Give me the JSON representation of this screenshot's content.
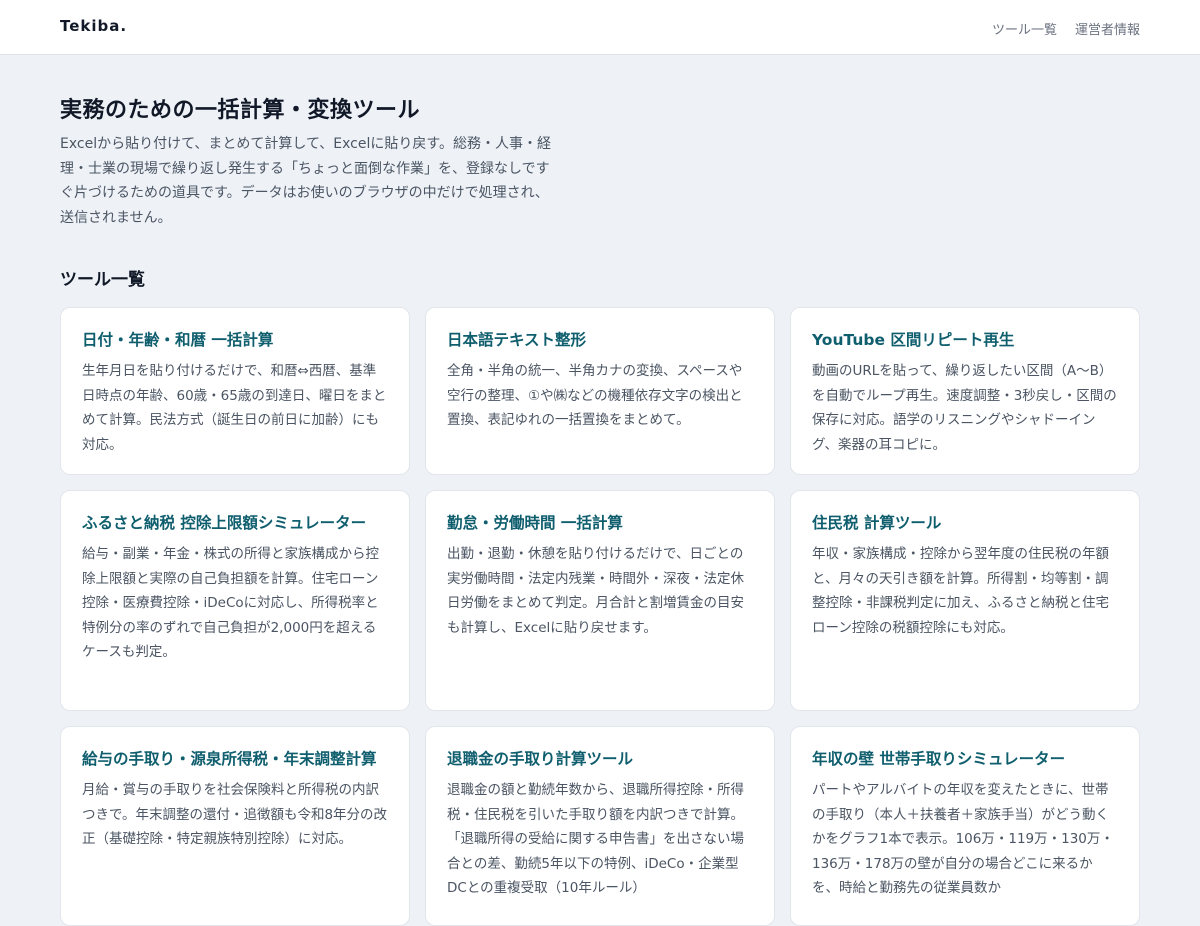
{
  "header": {
    "logo": "Tekiba.",
    "nav": [
      {
        "label": "ツール一覧"
      },
      {
        "label": "運営者情報"
      }
    ]
  },
  "hero": {
    "title": "実務のための一括計算・変換ツール",
    "description": "Excelから貼り付けて、まとめて計算して、Excelに貼り戻す。総務・人事・経理・士業の現場で繰り返し発生する「ちょっと面倒な作業」を、登録なしですぐ片づけるための道具です。データはお使いのブラウザの中だけで処理され、送信されません。"
  },
  "tools": {
    "section_title": "ツール一覧",
    "cards": [
      {
        "title": "日付・年齢・和暦 一括計算",
        "description": "生年月日を貼り付けるだけで、和暦⇔西暦、基準日時点の年齢、60歳・65歳の到達日、曜日をまとめて計算。民法方式（誕生日の前日に加齢）にも対応。"
      },
      {
        "title": "日本語テキスト整形",
        "description": "全角・半角の統一、半角カナの変換、スペースや空行の整理、①や㈱などの機種依存文字の検出と置換、表記ゆれの一括置換をまとめて。"
      },
      {
        "title": "YouTube 区間リピート再生",
        "description": "動画のURLを貼って、繰り返したい区間（A〜B）を自動でループ再生。速度調整・3秒戻し・区間の保存に対応。語学のリスニングやシャドーイング、楽器の耳コピに。"
      },
      {
        "title": "ふるさと納税 控除上限額シミュレーター",
        "description": "給与・副業・年金・株式の所得と家族構成から控除上限額と実際の自己負担額を計算。住宅ローン控除・医療費控除・iDeCoに対応し、所得税率と特例分の率のずれで自己負担が2,000円を超えるケースも判定。"
      },
      {
        "title": "勤怠・労働時間 一括計算",
        "description": "出勤・退勤・休憩を貼り付けるだけで、日ごとの実労働時間・法定内残業・時間外・深夜・法定休日労働をまとめて判定。月合計と割増賃金の目安も計算し、Excelに貼り戻せます。"
      },
      {
        "title": "住民税 計算ツール",
        "description": "年収・家族構成・控除から翌年度の住民税の年額と、月々の天引き額を計算。所得割・均等割・調整控除・非課税判定に加え、ふるさと納税と住宅ローン控除の税額控除にも対応。"
      },
      {
        "title": "給与の手取り・源泉所得税・年末調整計算",
        "description": "月給・賞与の手取りを社会保険料と所得税の内訳つきで。年末調整の還付・追徴額も令和8年分の改正（基礎控除・特定親族特別控除）に対応。"
      },
      {
        "title": "退職金の手取り計算ツール",
        "description": "退職金の額と勤続年数から、退職所得控除・所得税・住民税を引いた手取り額を内訳つきで計算。「退職所得の受給に関する申告書」を出さない場合との差、勤続5年以下の特例、iDeCo・企業型DCとの重複受取（10年ルール）"
      },
      {
        "title": "年収の壁 世帯手取りシミュレーター",
        "description": "パートやアルバイトの年収を変えたときに、世帯の手取り（本人＋扶養者＋家族手当）がどう動くかをグラフ1本で表示。106万・119万・130万・136万・178万の壁が自分の場合どこに来るかを、時給と勤務先の従業員数か"
      }
    ]
  }
}
